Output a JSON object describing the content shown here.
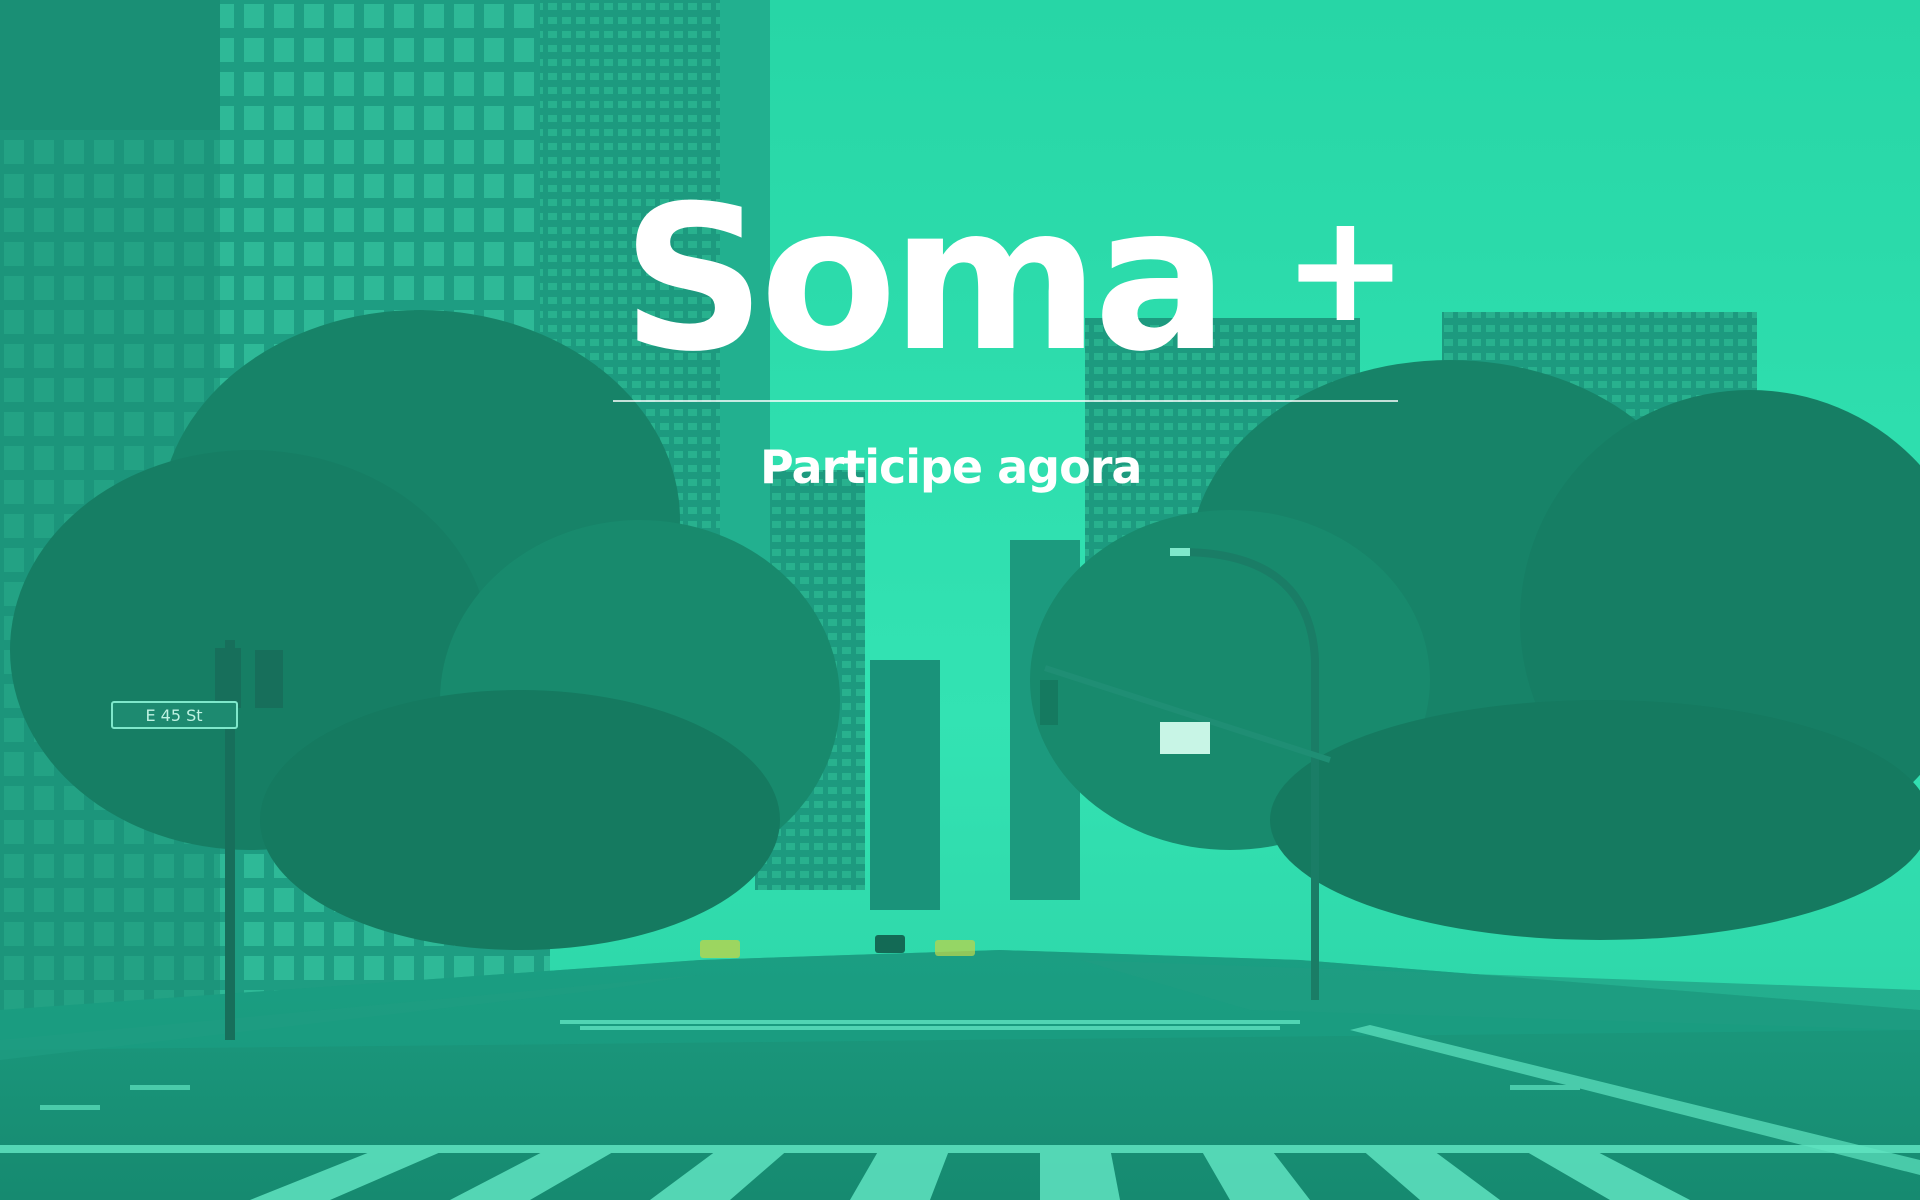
{
  "brand": {
    "name": "Soma",
    "plus": "+"
  },
  "cta": {
    "label": "Participe agora"
  },
  "street_sign": {
    "text": "E 45 St"
  },
  "colors": {
    "overlay": "#1fcc9f",
    "sky": "#2fe0b0",
    "text": "#ffffff"
  }
}
